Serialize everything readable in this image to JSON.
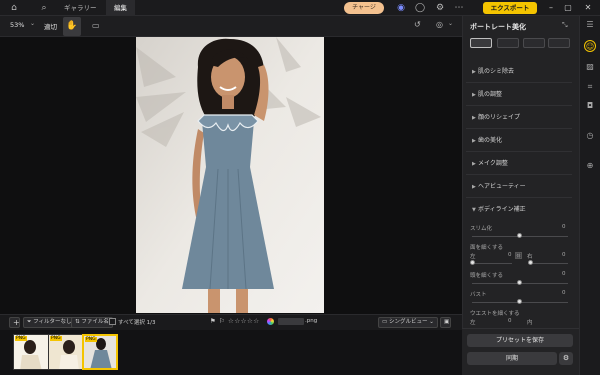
{
  "topbar": {
    "tabs": [
      "ギャラリー",
      "編集"
    ],
    "active_tab": "編集",
    "charge_label": "チャージ",
    "export_label": "エクスポート",
    "icons": [
      "home-icon",
      "search-icon",
      "discord-icon",
      "user-icon",
      "settings-icon",
      "more-icon",
      "minimize-icon",
      "maximize-icon",
      "close-icon"
    ]
  },
  "toolbar": {
    "zoom": "53%",
    "fit_label": "適切"
  },
  "bottom": {
    "filter_label": "フィルターなし",
    "file_label": "ファイル名",
    "select_all_label": "すべて選択 1/3",
    "filename_ext": ".png",
    "view_label": "シングルビュー"
  },
  "thumbnails": [
    {
      "tag": "PNG",
      "selected": false
    },
    {
      "tag": "PNG",
      "selected": false
    },
    {
      "tag": "PNG",
      "selected": true
    }
  ],
  "right_panel": {
    "title": "ポートレート美化",
    "sections": [
      {
        "label": "肌のシミ除去"
      },
      {
        "label": "肌の調整"
      },
      {
        "label": "顔のリシェイプ"
      },
      {
        "label": "歯の美化"
      },
      {
        "label": "メイク調整"
      },
      {
        "label": "ヘアビューティー"
      },
      {
        "label": "ボディライン補正"
      }
    ],
    "body_params": {
      "slim_label": "スリム化",
      "slim_value": "0",
      "arm_label": "面を細くする",
      "left_label": "左",
      "left_value": "0",
      "right_label": "右",
      "right_value": "0",
      "neck_label": "頭を細くする",
      "neck_value": "0",
      "bust_label": "バスト",
      "bust_value": "0",
      "waist_label": "ウエストを細くする",
      "waist_left": "左",
      "waist_value": "0",
      "waist_right": "内"
    },
    "save_preset_label": "プリセットを保存",
    "sync_label": "同期"
  },
  "colors": {
    "accent": "#f4c400",
    "charge": "#f3c18f",
    "dress": "#6f889b"
  }
}
